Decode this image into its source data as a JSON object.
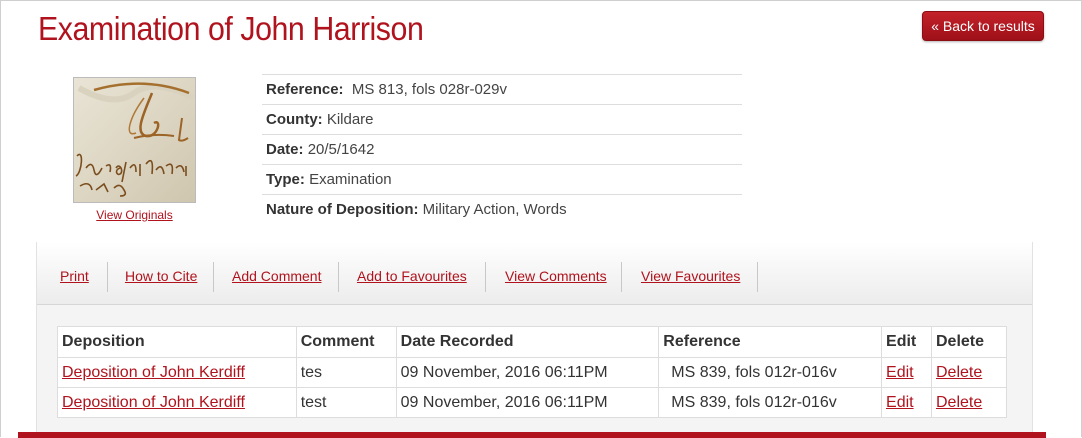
{
  "page": {
    "title": "Examination of John Harrison",
    "back_label": "« Back to results"
  },
  "thumbnail": {
    "link_label": "View Originals"
  },
  "metadata": [
    {
      "label": "Reference:",
      "value": "MS 813, fols 028r-029v"
    },
    {
      "label": "County:",
      "value": "Kildare"
    },
    {
      "label": "Date:",
      "value": "20/5/1642"
    },
    {
      "label": "Type:",
      "value": "Examination"
    },
    {
      "label": "Nature of Deposition:",
      "value": "Military Action, Words"
    }
  ],
  "toolbar": {
    "items": [
      "Print",
      "How to Cite",
      "Add Comment",
      "Add to Favourites",
      "View Comments",
      "View Favourites"
    ]
  },
  "comments_table": {
    "headers": [
      "Deposition",
      "Comment",
      "Date Recorded",
      "Reference",
      "Edit",
      "Delete"
    ],
    "rows": [
      {
        "deposition": "Deposition of John Kerdiff",
        "comment": "tes",
        "date": "09 November, 2016 06:11PM",
        "reference": "MS 839, fols 012r-016v",
        "edit": "Edit",
        "delete": "Delete"
      },
      {
        "deposition": "Deposition of John Kerdiff",
        "comment": "test",
        "date": "09 November, 2016 06:11PM",
        "reference": "MS 839, fols 012r-016v",
        "edit": "Edit",
        "delete": "Delete"
      }
    ]
  },
  "colors": {
    "accent": "#b0131d",
    "toolbar_bg": "#f4f4f4"
  }
}
